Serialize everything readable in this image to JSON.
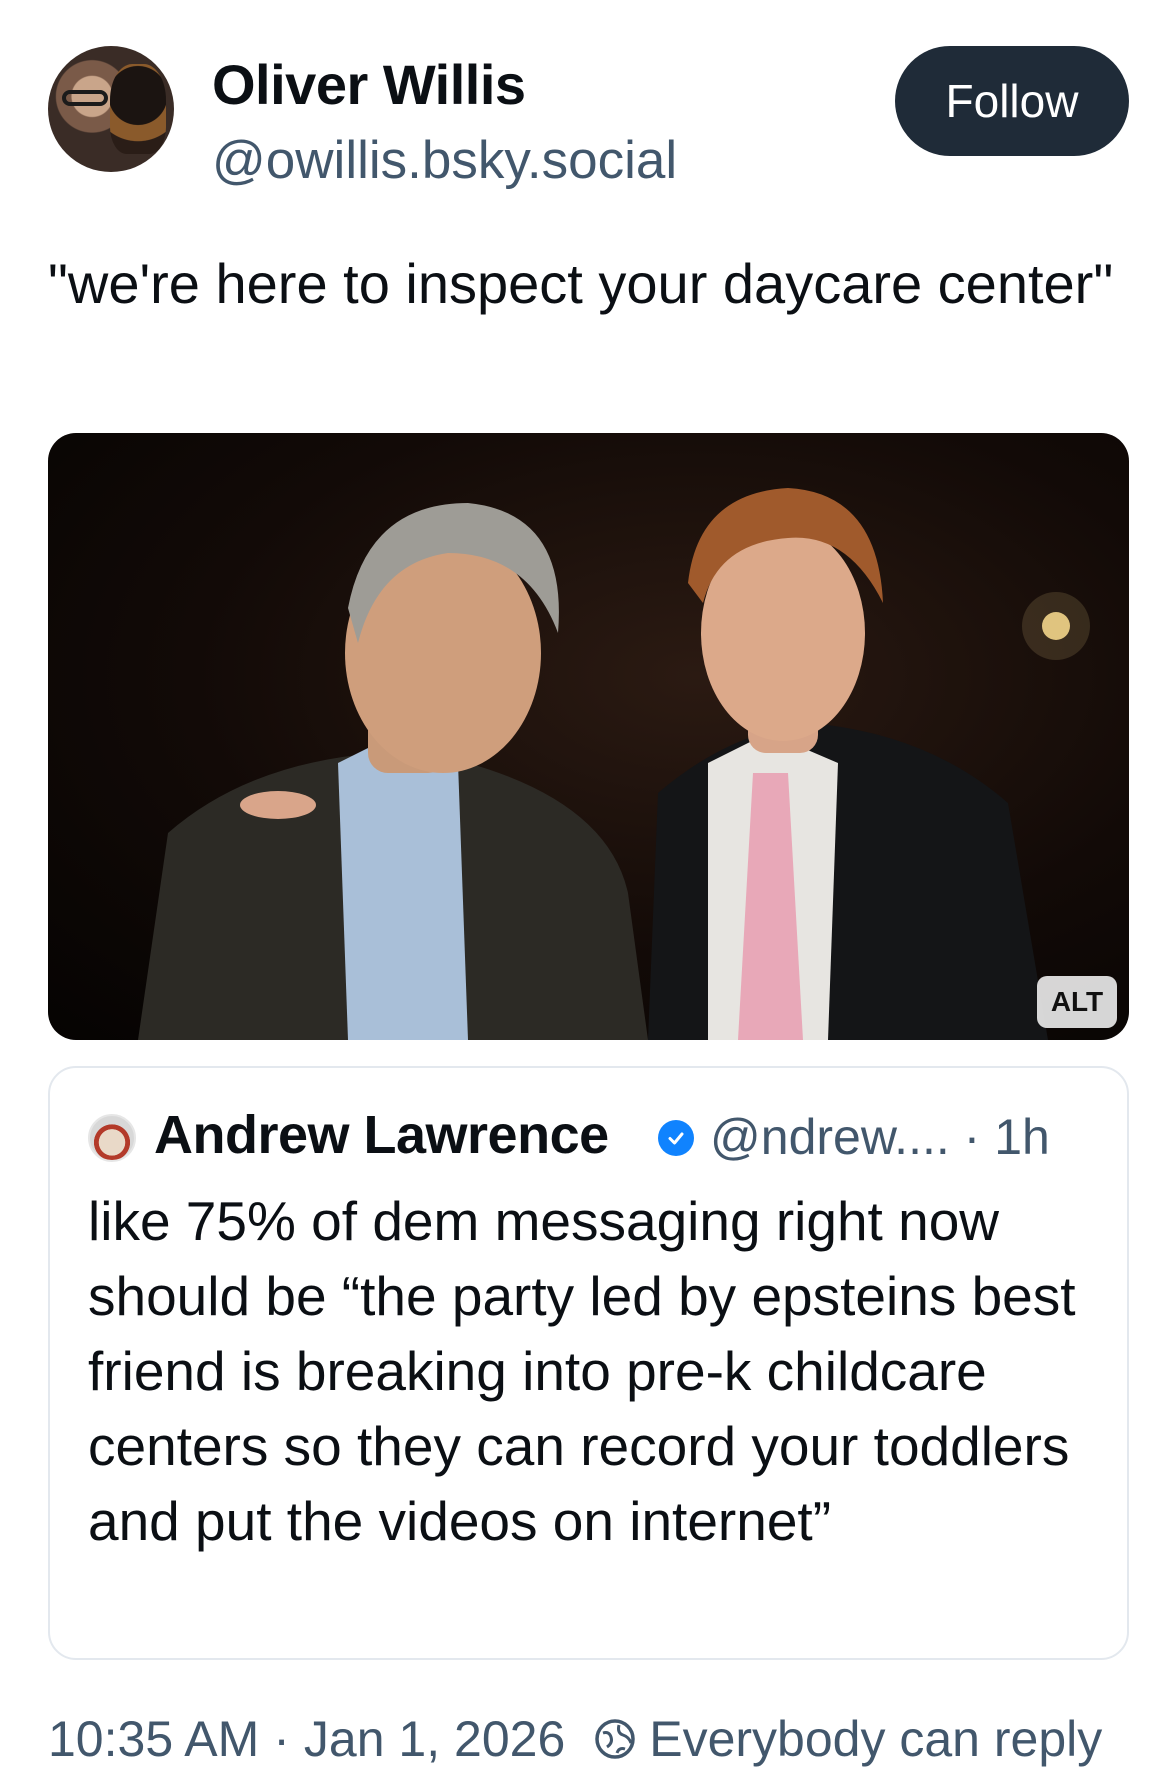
{
  "author": {
    "display_name": "Oliver Willis",
    "handle": "@owillis.bsky.social",
    "follow_label": "Follow"
  },
  "post": {
    "text": "\"we're here to inspect your daycare center\"",
    "image": {
      "alt_label": "ALT"
    }
  },
  "quoted_post": {
    "display_name": "Andrew Lawrence",
    "handle": "@ndrew....",
    "age": "1h",
    "text": "like 75% of dem messaging right now should be “the party led by epsteins best friend is breaking into pre-k childcare centers so they can record your toddlers and put the videos on internet”"
  },
  "footer": {
    "time": "10:35 AM",
    "date": "Jan 1, 2026",
    "reply_setting": "Everybody can reply"
  },
  "colors": {
    "follow_button_bg": "#1f2b38",
    "secondary_text": "#42576c",
    "verified_blue": "#1083fe"
  }
}
